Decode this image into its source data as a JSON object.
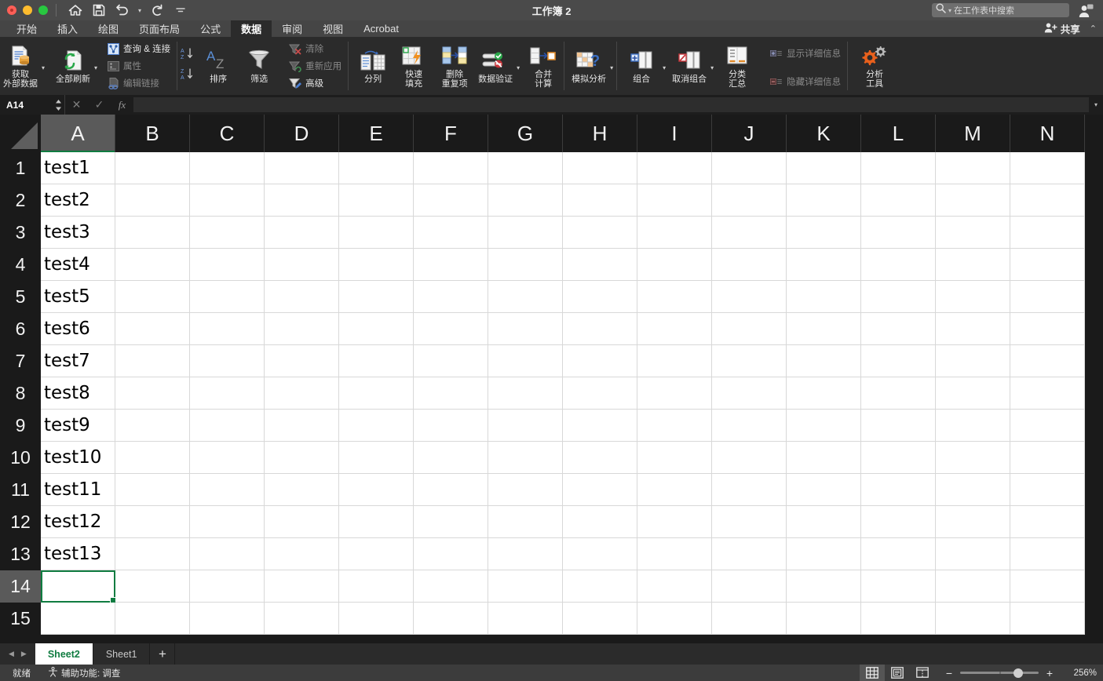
{
  "window": {
    "title": "工作簿 2",
    "traffic_lights": [
      "close",
      "minimize",
      "maximize"
    ],
    "quick_access": [
      {
        "name": "home-icon",
        "label": "主页"
      },
      {
        "name": "save-icon",
        "label": "保存"
      },
      {
        "name": "undo-icon",
        "label": "撤消"
      },
      {
        "name": "redo-icon",
        "label": "恢复"
      },
      {
        "name": "customize-qat-icon",
        "label": "自定义快速访问工具栏"
      }
    ]
  },
  "search": {
    "placeholder": "在工作表中搜索",
    "icon": "search-icon"
  },
  "account": {
    "icon": "account-icon"
  },
  "ribbon": {
    "tabs": [
      {
        "label": "开始",
        "active": false
      },
      {
        "label": "插入",
        "active": false
      },
      {
        "label": "绘图",
        "active": false
      },
      {
        "label": "页面布局",
        "active": false
      },
      {
        "label": "公式",
        "active": false
      },
      {
        "label": "数据",
        "active": true
      },
      {
        "label": "审阅",
        "active": false
      },
      {
        "label": "视图",
        "active": false
      },
      {
        "label": "Acrobat",
        "active": false
      }
    ],
    "share": {
      "label": "共享",
      "icon": "share-person-icon"
    },
    "collapse": {
      "icon": "chevron-up-icon"
    },
    "groups": {
      "external_data": {
        "get_external_data": {
          "label": "获取\n外部数据",
          "icon": "get-external-data-icon",
          "has_caret": true
        },
        "refresh_all": {
          "label": "全部刷新",
          "icon": "refresh-all-icon",
          "has_caret": true
        },
        "queries_connections": {
          "label": "查询 & 连接",
          "icon": "queries-connections-icon",
          "disabled": false
        },
        "properties": {
          "label": "属性",
          "icon": "properties-icon",
          "disabled": true
        },
        "edit_links": {
          "label": "编辑链接",
          "icon": "edit-links-icon",
          "disabled": true
        }
      },
      "sort_filter": {
        "sort_az": {
          "label": "升序排序",
          "icon": "sort-az-icon"
        },
        "sort_za": {
          "label": "降序排序",
          "icon": "sort-za-icon"
        },
        "sort": {
          "label": "排序",
          "icon": "sort-icon"
        },
        "filter": {
          "label": "筛选",
          "icon": "filter-icon"
        },
        "clear": {
          "label": "清除",
          "icon": "clear-filter-icon",
          "disabled": true
        },
        "reapply": {
          "label": "重新应用",
          "icon": "reapply-filter-icon",
          "disabled": true
        },
        "advanced": {
          "label": "高级",
          "icon": "advanced-filter-icon",
          "disabled": false
        }
      },
      "data_tools": {
        "text_to_columns": {
          "label": "分列",
          "icon": "text-to-columns-icon"
        },
        "flash_fill": {
          "label": "快速\n填充",
          "icon": "flash-fill-icon"
        },
        "remove_duplicates": {
          "label": "删除\n重复项",
          "icon": "remove-duplicates-icon"
        },
        "data_validation": {
          "label": "数据验证",
          "icon": "data-validation-icon",
          "has_caret": true
        },
        "consolidate": {
          "label": "合并\n计算",
          "icon": "consolidate-icon"
        }
      },
      "forecast": {
        "what_if": {
          "label": "模拟分析",
          "icon": "what-if-analysis-icon",
          "has_caret": true
        }
      },
      "outline": {
        "group": {
          "label": "组合",
          "icon": "group-icon",
          "has_caret": true
        },
        "ungroup": {
          "label": "取消组合",
          "icon": "ungroup-icon",
          "has_caret": true
        },
        "subtotal": {
          "label": "分类\n汇总",
          "icon": "subtotal-icon"
        },
        "show_detail": {
          "label": "显示详细信息",
          "icon": "show-detail-icon",
          "disabled": true
        },
        "hide_detail": {
          "label": "隐藏详细信息",
          "icon": "hide-detail-icon",
          "disabled": true
        }
      },
      "analysis": {
        "analysis_tools": {
          "label": "分析\n工具",
          "icon": "analysis-tools-icon"
        }
      }
    }
  },
  "formula_bar": {
    "name_box": "A14",
    "cancel": {
      "icon": "cancel-icon",
      "disabled": true
    },
    "enter": {
      "icon": "check-icon",
      "disabled": true
    },
    "insert_function": {
      "icon": "fx-icon"
    },
    "value": "",
    "expand": {
      "icon": "chevron-down-icon"
    }
  },
  "grid": {
    "columns": [
      "A",
      "B",
      "C",
      "D",
      "E",
      "F",
      "G",
      "H",
      "I",
      "J",
      "K",
      "L",
      "M",
      "N"
    ],
    "active_column": "A",
    "rows": [
      {
        "number": "1",
        "values": [
          "test1"
        ]
      },
      {
        "number": "2",
        "values": [
          "test2"
        ]
      },
      {
        "number": "3",
        "values": [
          "test3"
        ]
      },
      {
        "number": "4",
        "values": [
          "test4"
        ]
      },
      {
        "number": "5",
        "values": [
          "test5"
        ]
      },
      {
        "number": "6",
        "values": [
          "test6"
        ]
      },
      {
        "number": "7",
        "values": [
          "test7"
        ]
      },
      {
        "number": "8",
        "values": [
          "test8"
        ]
      },
      {
        "number": "9",
        "values": [
          "test9"
        ]
      },
      {
        "number": "10",
        "values": [
          "test10"
        ]
      },
      {
        "number": "11",
        "values": [
          "test11"
        ]
      },
      {
        "number": "12",
        "values": [
          "test12"
        ]
      },
      {
        "number": "13",
        "values": [
          "test13"
        ]
      },
      {
        "number": "14",
        "values": [
          ""
        ]
      },
      {
        "number": "15",
        "values": [
          ""
        ]
      }
    ],
    "selected_cell": "A14",
    "selected_row": "14"
  },
  "sheets": {
    "nav_prev": {
      "icon": "triangle-left-icon"
    },
    "nav_next": {
      "icon": "triangle-right-icon"
    },
    "tabs": [
      {
        "label": "Sheet2",
        "active": true
      },
      {
        "label": "Sheet1",
        "active": false
      }
    ],
    "add": {
      "label": "+",
      "icon": "plus-icon"
    }
  },
  "status_bar": {
    "state": "就绪",
    "accessibility": {
      "icon": "accessibility-icon",
      "label": "辅助功能: 调查"
    },
    "views": [
      {
        "name": "normal-view",
        "icon": "grid-view-icon",
        "active": true
      },
      {
        "name": "page-layout-view",
        "icon": "page-layout-icon",
        "active": false
      },
      {
        "name": "page-break-view",
        "icon": "page-break-icon",
        "active": false
      }
    ],
    "zoom": {
      "minus": "−",
      "plus": "+",
      "level": "256%"
    }
  },
  "colors": {
    "accent_green": "#107c41",
    "titlebar": "#4a4a4a",
    "ribbon_bg": "#2b2b2b",
    "grid_header": "#1a1a1a",
    "status_bg": "#3c3c3c"
  }
}
